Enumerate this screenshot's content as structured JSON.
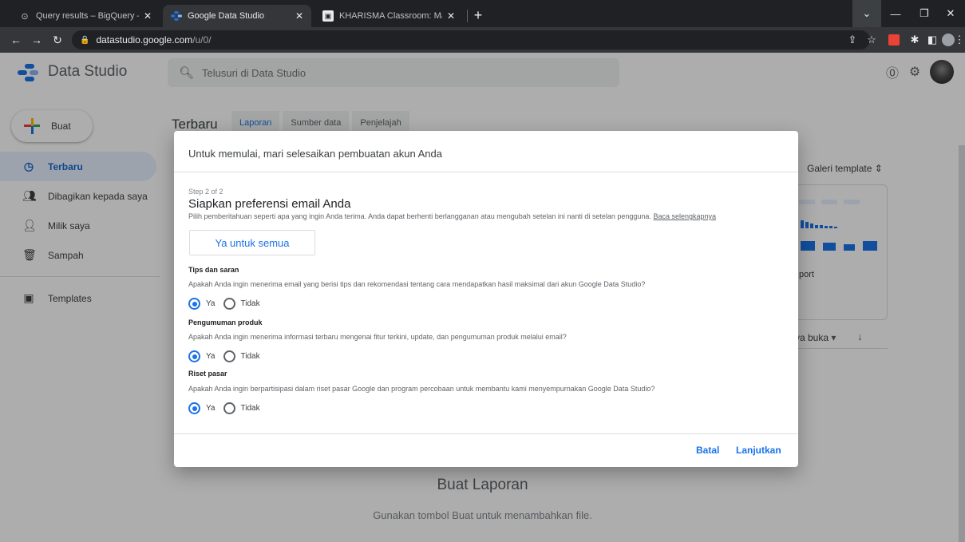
{
  "browser": {
    "tabs": [
      {
        "title": "Query results – BigQuery – My Fi",
        "active": false
      },
      {
        "title": "Google Data Studio",
        "active": true
      },
      {
        "title": "KHARISMA Classroom: Masuk ke",
        "active": false
      }
    ],
    "url_host": "datastudio.google.com",
    "url_path": "/u/0/"
  },
  "app": {
    "title": "Data Studio",
    "search_placeholder": "Telusuri di Data Studio",
    "colors": {
      "accent": "#1a73e8",
      "logo_blue": "#1a73e8",
      "logo_red": "#ea4335",
      "logo_yellow": "#fbbc04",
      "logo_green": "#34a853"
    }
  },
  "sidebar": {
    "create_label": "Buat",
    "items": [
      {
        "label": "Terbaru",
        "icon": "clock-icon",
        "active": true
      },
      {
        "label": "Dibagikan kepada saya",
        "icon": "people-icon",
        "active": false
      },
      {
        "label": "Milik saya",
        "icon": "person-icon",
        "active": false
      },
      {
        "label": "Sampah",
        "icon": "trash-icon",
        "active": false
      }
    ],
    "templates_label": "Templates"
  },
  "main": {
    "title": "Terbaru",
    "tabs": [
      "Laporan",
      "Sumber data",
      "Penjelajah"
    ],
    "gallery_label": "Galeri template",
    "gallery_card_caption": "port",
    "sort_label": "ya buka",
    "empty_title": "Buat Laporan",
    "empty_subtitle": "Gunakan tombol Buat untuk menambahkan file."
  },
  "dialog": {
    "header": "Untuk memulai, mari selesaikan pembuatan akun Anda",
    "step": "Step 2 of 2",
    "title": "Siapkan preferensi email Anda",
    "description": "Pilih pemberitahuan seperti apa yang ingin Anda terima. Anda dapat berhenti berlangganan atau mengubah setelan ini nanti di setelan pengguna.",
    "learn_more": "Baca selengkapnya",
    "yes_all": "Ya untuk semua",
    "sections": [
      {
        "title": "Tips dan saran",
        "description": "Apakah Anda ingin menerima email yang berisi tips dan rekomendasi tentang cara mendapatkan hasil maksimal dari akun Google Data Studio?",
        "yes": "Ya",
        "no": "Tidak",
        "selected": "yes"
      },
      {
        "title": "Pengumuman produk",
        "description": "Apakah Anda ingin menerima informasi terbaru mengenai fitur terkini, update, dan pengumuman produk melalui email?",
        "yes": "Ya",
        "no": "Tidak",
        "selected": "yes"
      },
      {
        "title": "Riset pasar",
        "description": "Apakah Anda ingin berpartisipasi dalam riset pasar Google dan program percobaan untuk membantu kami menyempurnakan Google Data Studio?",
        "yes": "Ya",
        "no": "Tidak",
        "selected": "yes"
      }
    ],
    "cancel": "Batal",
    "continue": "Lanjutkan"
  }
}
